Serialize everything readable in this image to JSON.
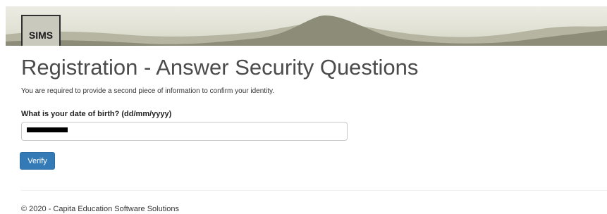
{
  "header": {
    "logo_text": "SIMS"
  },
  "page": {
    "title": "Registration - Answer Security Questions",
    "intro": "You are required to provide a second piece of information to confirm your identity."
  },
  "form": {
    "question_label": "What is your date of birth? (dd/mm/yyyy)",
    "dob_value": "",
    "verify_label": "Verify"
  },
  "footer": {
    "text": "© 2020 - Capita Education Software Solutions"
  },
  "colors": {
    "primary_button": "#337ab7",
    "banner_background": "#e4e4d8",
    "mountain_dark": "#7c7c6a"
  }
}
